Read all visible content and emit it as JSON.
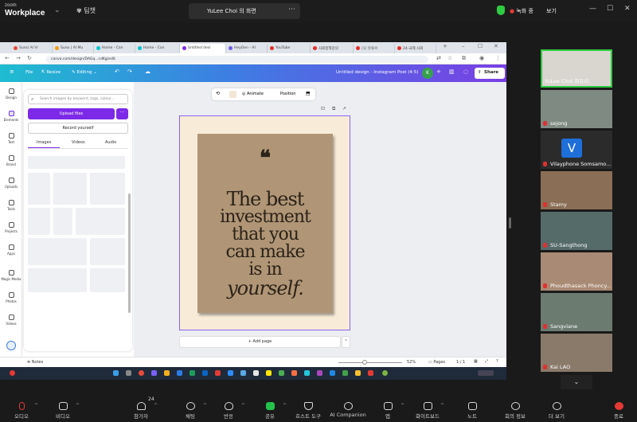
{
  "zoom": {
    "logo_top": "zoom",
    "logo_bottom": "Workplace",
    "team_label": "팀챗",
    "share_title": "YuLee Choi 의 화면",
    "recording_label": "녹화 중",
    "view_label": "보기"
  },
  "browser": {
    "tabs": [
      {
        "label": "Sunsi AI Vi",
        "color": "#e74c3c"
      },
      {
        "label": "Suno | AI Mu",
        "color": "#f39c12"
      },
      {
        "label": "Home - Can",
        "color": "#00c4cc"
      },
      {
        "label": "Home - Can",
        "color": "#00c4cc"
      },
      {
        "label": "Untitled desi",
        "color": "#7d2ae8"
      },
      {
        "label": "HeyGen - AI",
        "color": "#6c5ce7"
      },
      {
        "label": "YouTube",
        "color": "#e52d27"
      },
      {
        "label": "사회정책강의",
        "color": "#e52d27"
      },
      {
        "label": "(1) 유튜브",
        "color": "#e52d27"
      },
      {
        "label": "24-국제 사회",
        "color": "#e52d27"
      }
    ],
    "url": "canva.com/design/DAGq...cdKg/edit"
  },
  "canva": {
    "file": "File",
    "resize": "Resize",
    "editing": "Editing",
    "title": "Untitled design - Instagram Post (4:5)",
    "avatar": "K",
    "share": "Share",
    "rail": [
      "Design",
      "Elements",
      "Text",
      "Brand",
      "Uploads",
      "Tools",
      "Projects",
      "Apps",
      "Magic Media",
      "Photos",
      "Videos"
    ],
    "search_placeholder": "Search images by keyword, tags, colour...",
    "upload_label": "Upload files",
    "upload_more": "···",
    "record_label": "Record yourself",
    "panel_tabs": [
      "Images",
      "Videos",
      "Audio"
    ],
    "animate": "Animate",
    "position": "Position",
    "add_page": "+ Add page",
    "notes": "Notes",
    "zoom": "52%",
    "pages": "Pages",
    "page_count": "1 / 1"
  },
  "poster": {
    "quote_mark": "❝",
    "lines": [
      "The best",
      "investment",
      "that you",
      "can make",
      "is in",
      "yourself."
    ]
  },
  "participants": [
    {
      "name": "YuLee Choi 최유리",
      "muted": false,
      "bg": "#d9d5cf"
    },
    {
      "name": "sejong",
      "muted": true,
      "bg": "#7f8a82"
    },
    {
      "name": "Vilayphone Somsamo...",
      "muted": true,
      "bg": "#2b2b2b",
      "initial": "V"
    },
    {
      "name": "Stamy",
      "muted": true,
      "bg": "#8a6e55"
    },
    {
      "name": "SU-Sangthong",
      "muted": true,
      "bg": "#556b6a"
    },
    {
      "name": "Phoudthasack Phoncy...",
      "muted": true,
      "bg": "#a98a74"
    },
    {
      "name": "Sangviane",
      "muted": true,
      "bg": "#6b7b70"
    },
    {
      "name": "Kai LAO",
      "muted": true,
      "bg": "#8a7a6a"
    }
  ],
  "toolbar": [
    {
      "label": "오디오"
    },
    {
      "label": "비디오"
    },
    {
      "label": "참가자",
      "badge": "24"
    },
    {
      "label": "채팅"
    },
    {
      "label": "반응"
    },
    {
      "label": "공유"
    },
    {
      "label": "호스트 도구"
    },
    {
      "label": "AI Companion"
    },
    {
      "label": "앱"
    },
    {
      "label": "화이트보드"
    },
    {
      "label": "노트"
    },
    {
      "label": "회의 정보"
    },
    {
      "label": "더 보기"
    },
    {
      "label": "종료"
    }
  ]
}
